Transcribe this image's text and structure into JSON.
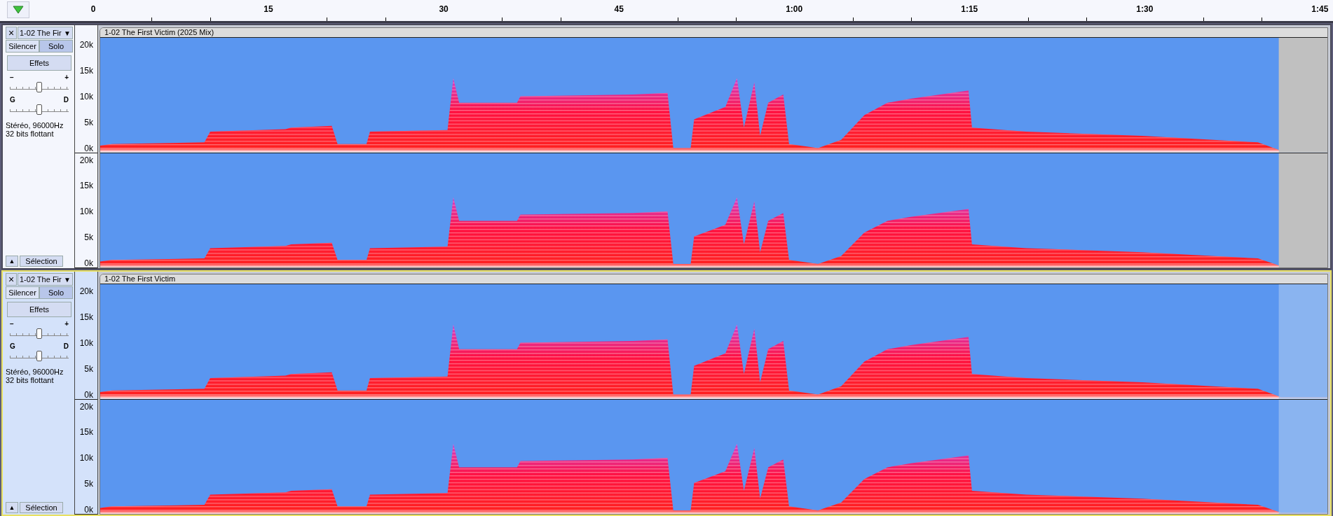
{
  "ruler": {
    "ticks": [
      "0",
      "15",
      "30",
      "45",
      "1:00",
      "1:15",
      "1:30",
      "1:45"
    ]
  },
  "tracks": [
    {
      "selected": false,
      "name": "1-02 The Fir",
      "menu_arrow": "▼",
      "close": "×",
      "mute": {
        "label": "Silencer",
        "on": false
      },
      "solo": {
        "label": "Solo",
        "on": true
      },
      "effects": "Effets",
      "gain": {
        "min": "−",
        "max": "+",
        "level": 0.5
      },
      "pan": {
        "min": "G",
        "max": "D",
        "level": 0.5
      },
      "info": [
        "Stéréo, 96000Hz",
        "32 bits flottant"
      ],
      "collapse": "▲",
      "select": "Sélection",
      "clip_title": "1-02 The First Victim (2025 Mix)",
      "channels": [
        {
          "scale": [
            "20k",
            "15k",
            "10k",
            "5k",
            "0k"
          ]
        },
        {
          "scale": [
            "20k",
            "15k",
            "10k",
            "5k",
            "0k"
          ]
        }
      ]
    },
    {
      "selected": true,
      "name": "1-02 The Fir",
      "menu_arrow": "▼",
      "close": "×",
      "mute": {
        "label": "Silencer",
        "on": false
      },
      "solo": {
        "label": "Solo",
        "on": true
      },
      "effects": "Effets",
      "gain": {
        "min": "−",
        "max": "+",
        "level": 0.5
      },
      "pan": {
        "min": "G",
        "max": "D",
        "level": 0.5
      },
      "info": [
        "Stéréo, 96000Hz",
        "32 bits flottant"
      ],
      "collapse": "▲",
      "select": "Sélection",
      "clip_title": "1-02 The First Victim",
      "channels": [
        {
          "scale": [
            "20k",
            "15k",
            "10k",
            "5k",
            "0k"
          ]
        },
        {
          "scale": [
            "20k",
            "15k",
            "10k",
            "5k",
            "0k"
          ]
        }
      ]
    }
  ]
}
